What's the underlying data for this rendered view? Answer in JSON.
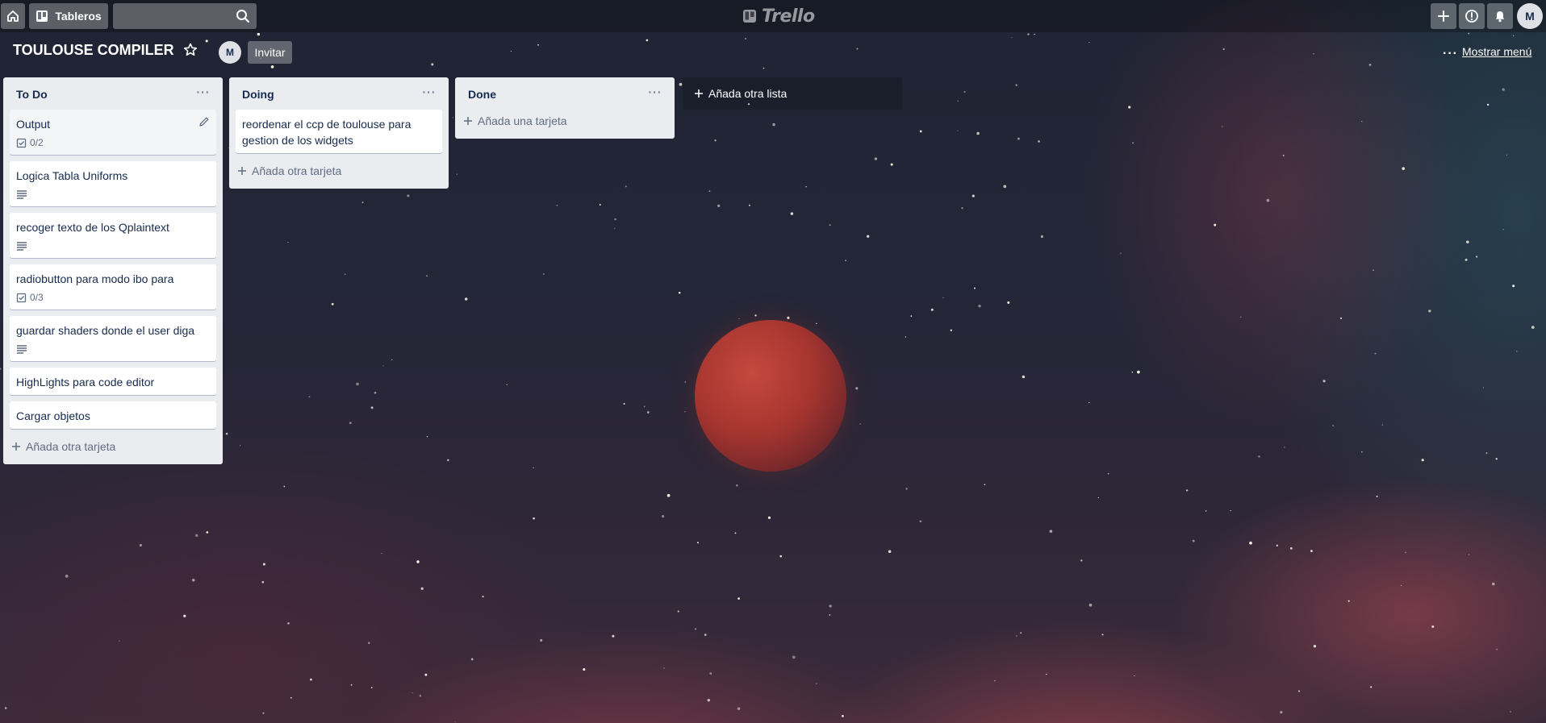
{
  "header": {
    "boards_label": "Tableros",
    "search_placeholder": "",
    "logo_text": "Trello",
    "avatar_initial": "M"
  },
  "board": {
    "title": "TOULOUSE COMPILER",
    "member_initial": "M",
    "invite_label": "Invitar",
    "show_menu_label": "Mostrar menú",
    "add_list_label": "Añada otra lista"
  },
  "lists": [
    {
      "title": "To Do",
      "add_label": "Añada otra tarjeta",
      "cards": [
        {
          "title": "Output",
          "checklist": "0/2"
        },
        {
          "title": "Logica Tabla Uniforms"
        },
        {
          "title": "recoger texto de los Qplaintext"
        },
        {
          "title": "radiobutton para modo ibo para",
          "checklist": "0/3"
        },
        {
          "title": "guardar shaders donde el user diga"
        },
        {
          "title": "HighLights para code editor"
        },
        {
          "title": "Cargar objetos"
        }
      ]
    },
    {
      "title": "Doing",
      "add_label": "Añada otra tarjeta",
      "cards": [
        {
          "title": "reordenar el ccp de toulouse para gestion de los widgets"
        }
      ]
    },
    {
      "title": "Done",
      "add_label": "Añada una tarjeta",
      "cards": []
    }
  ],
  "colors": {
    "list_bg": "#ebecf0",
    "card_bg": "#ffffff",
    "text_primary": "#172b4d",
    "text_secondary": "#5e6c84"
  }
}
